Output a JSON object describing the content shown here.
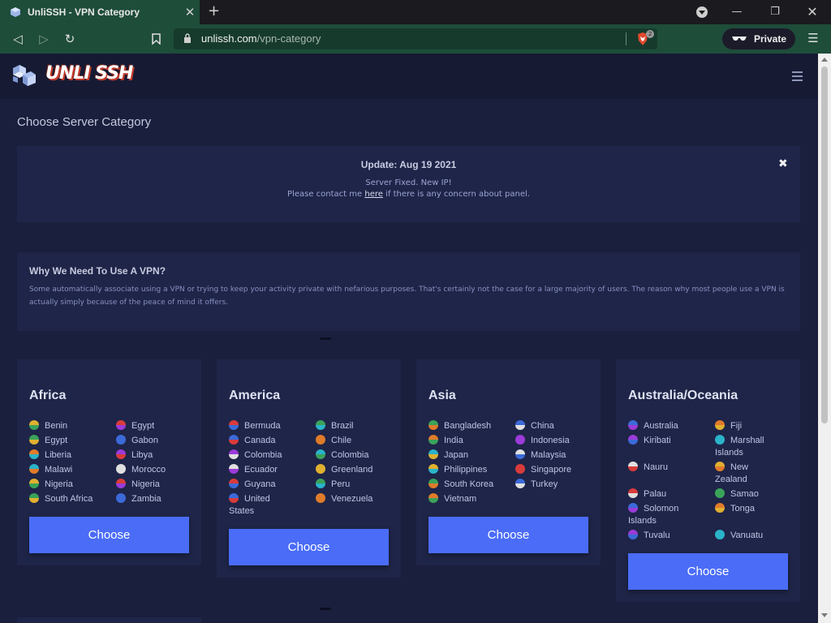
{
  "browser": {
    "tab_title": "UnliSSH - VPN Category",
    "url_host": "unlissh.com",
    "url_path": "/vpn-category",
    "shields_count": "2",
    "private_label": "Private"
  },
  "site": {
    "logo_text": "UNLI SSH",
    "page_title": "Choose Server Category"
  },
  "notice": {
    "title": "Update: Aug 19 2021",
    "line1": "Server Fixed. New IP!",
    "line2_before": "Please contact me ",
    "line2_link": "here",
    "line2_after": " if there is any concern about panel.",
    "close": "✖"
  },
  "why": {
    "title": "Why We Need To Use A VPN?",
    "body": "Some automatically associate using a VPN or trying to keep your activity private with nefarious purposes. That's certainly not the case for a large majority of users. The reason why most people use a VPN is actually simply because of the peace of mind it offers."
  },
  "categories": [
    {
      "name": "Africa",
      "countries": [
        "Benin",
        "Egypt",
        "Egypt",
        "Gabon",
        "Liberia",
        "Libya",
        "Malawi",
        "Morocco",
        "Nigeria",
        "Nigeria",
        "South Africa",
        "Zambia"
      ],
      "button": "Choose"
    },
    {
      "name": "America",
      "countries": [
        "Bermuda",
        "Brazil",
        "Canada",
        "Chile",
        "Colombia",
        "Colombia",
        "Ecuador",
        "Greenland",
        "Guyana",
        "Peru",
        "United States",
        "Venezuela"
      ],
      "button": "Choose"
    },
    {
      "name": "Asia",
      "countries": [
        "Bangladesh",
        "China",
        "India",
        "Indonesia",
        "Japan",
        "Malaysia",
        "Philippines",
        "Singapore",
        "South Korea",
        "Turkey",
        "Vietnam"
      ],
      "button": "Choose"
    },
    {
      "name": "Australia/Oceania",
      "countries": [
        "Australia",
        "Fiji",
        "Kiribati",
        "Marshall Islands",
        "Nauru",
        "New Zealand",
        "Palau",
        "Samao",
        "Solomon Islands",
        "Tonga",
        "Tuvalu",
        "Vanuatu"
      ],
      "button": "Choose"
    }
  ],
  "colors": {
    "page_bg": "#1a1f3d",
    "card_bg": "#1f2548",
    "accent": "#4a6cf7",
    "browser_green": "#1e4d3a"
  }
}
